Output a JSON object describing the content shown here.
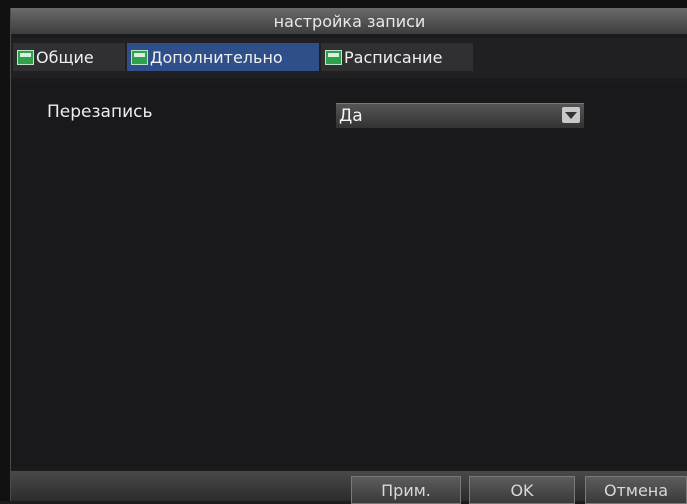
{
  "window": {
    "title": "настройка записи"
  },
  "tabs": [
    {
      "label": "Общие",
      "active": false
    },
    {
      "label": "Дополнительно",
      "active": true
    },
    {
      "label": "Расписание",
      "active": false
    }
  ],
  "settings": {
    "overwrite": {
      "label": "Перезапись",
      "value": "Да"
    }
  },
  "buttons": {
    "apply": "Прим.",
    "ok": "OK",
    "cancel": "Отмена"
  },
  "colors": {
    "active_tab": "#2f4f8a",
    "tab_icon": "#2fa14e"
  }
}
